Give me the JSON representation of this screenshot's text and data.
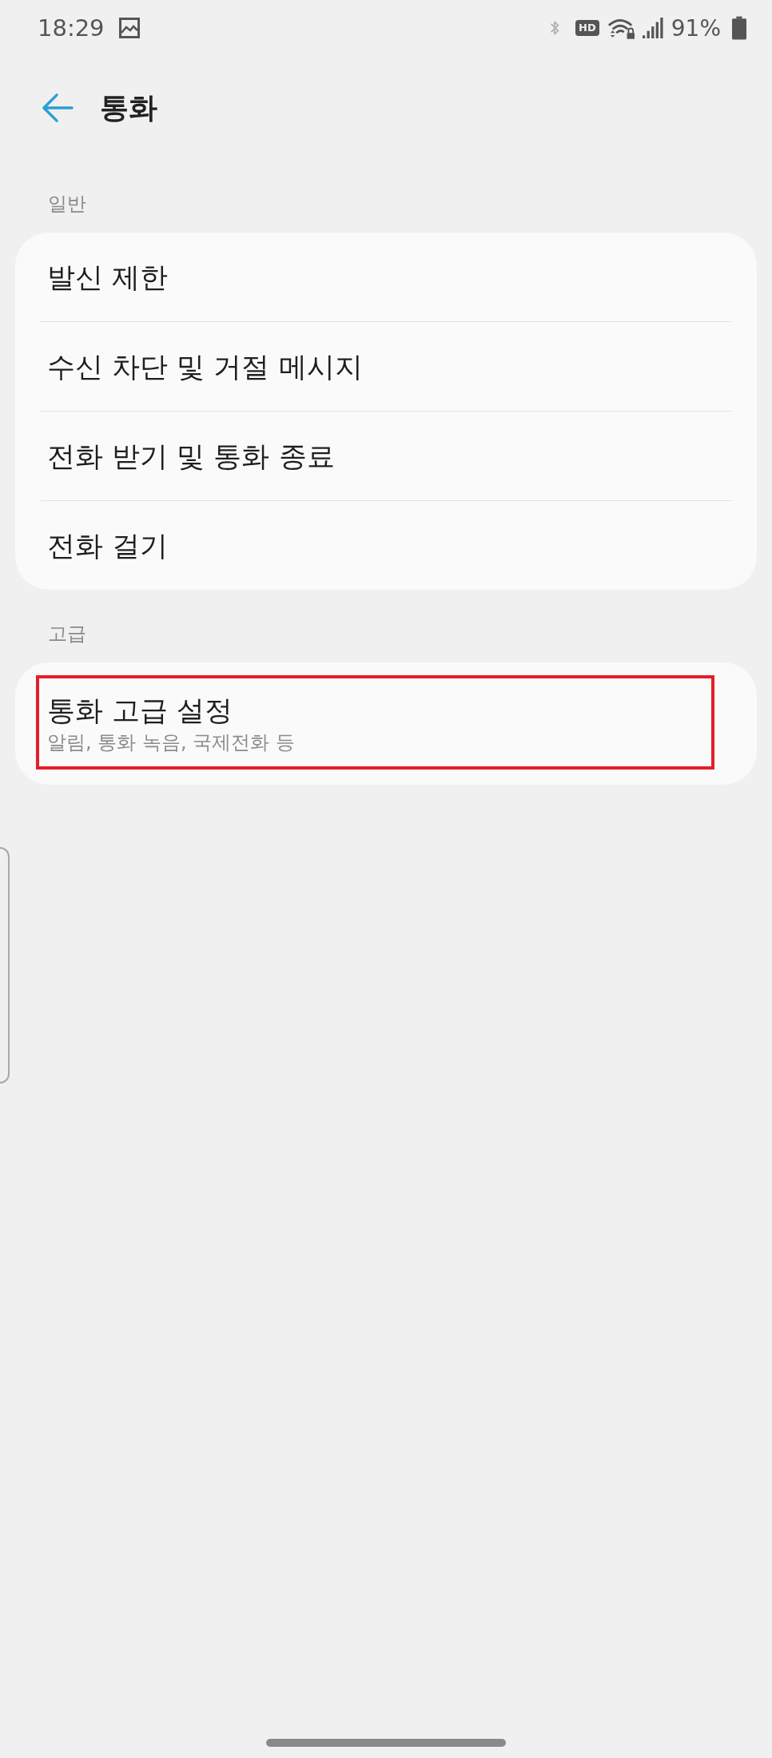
{
  "status_bar": {
    "time": "18:29",
    "hd_label": "HD",
    "battery_text": "91%"
  },
  "header": {
    "title": "통화"
  },
  "sections": [
    {
      "heading": "일반",
      "items": [
        {
          "title": "발신 제한",
          "highlighted": false
        },
        {
          "title": "수신 차단 및 거절 메시지",
          "highlighted": false
        },
        {
          "title": "전화 받기 및 통화 종료",
          "highlighted": false
        },
        {
          "title": "전화 걸기",
          "highlighted": false
        }
      ]
    },
    {
      "heading": "고급",
      "items": [
        {
          "title": "통화 고급 설정",
          "subtitle": "알림, 통화 녹음, 국제전화 등",
          "highlighted": true
        }
      ]
    }
  ]
}
